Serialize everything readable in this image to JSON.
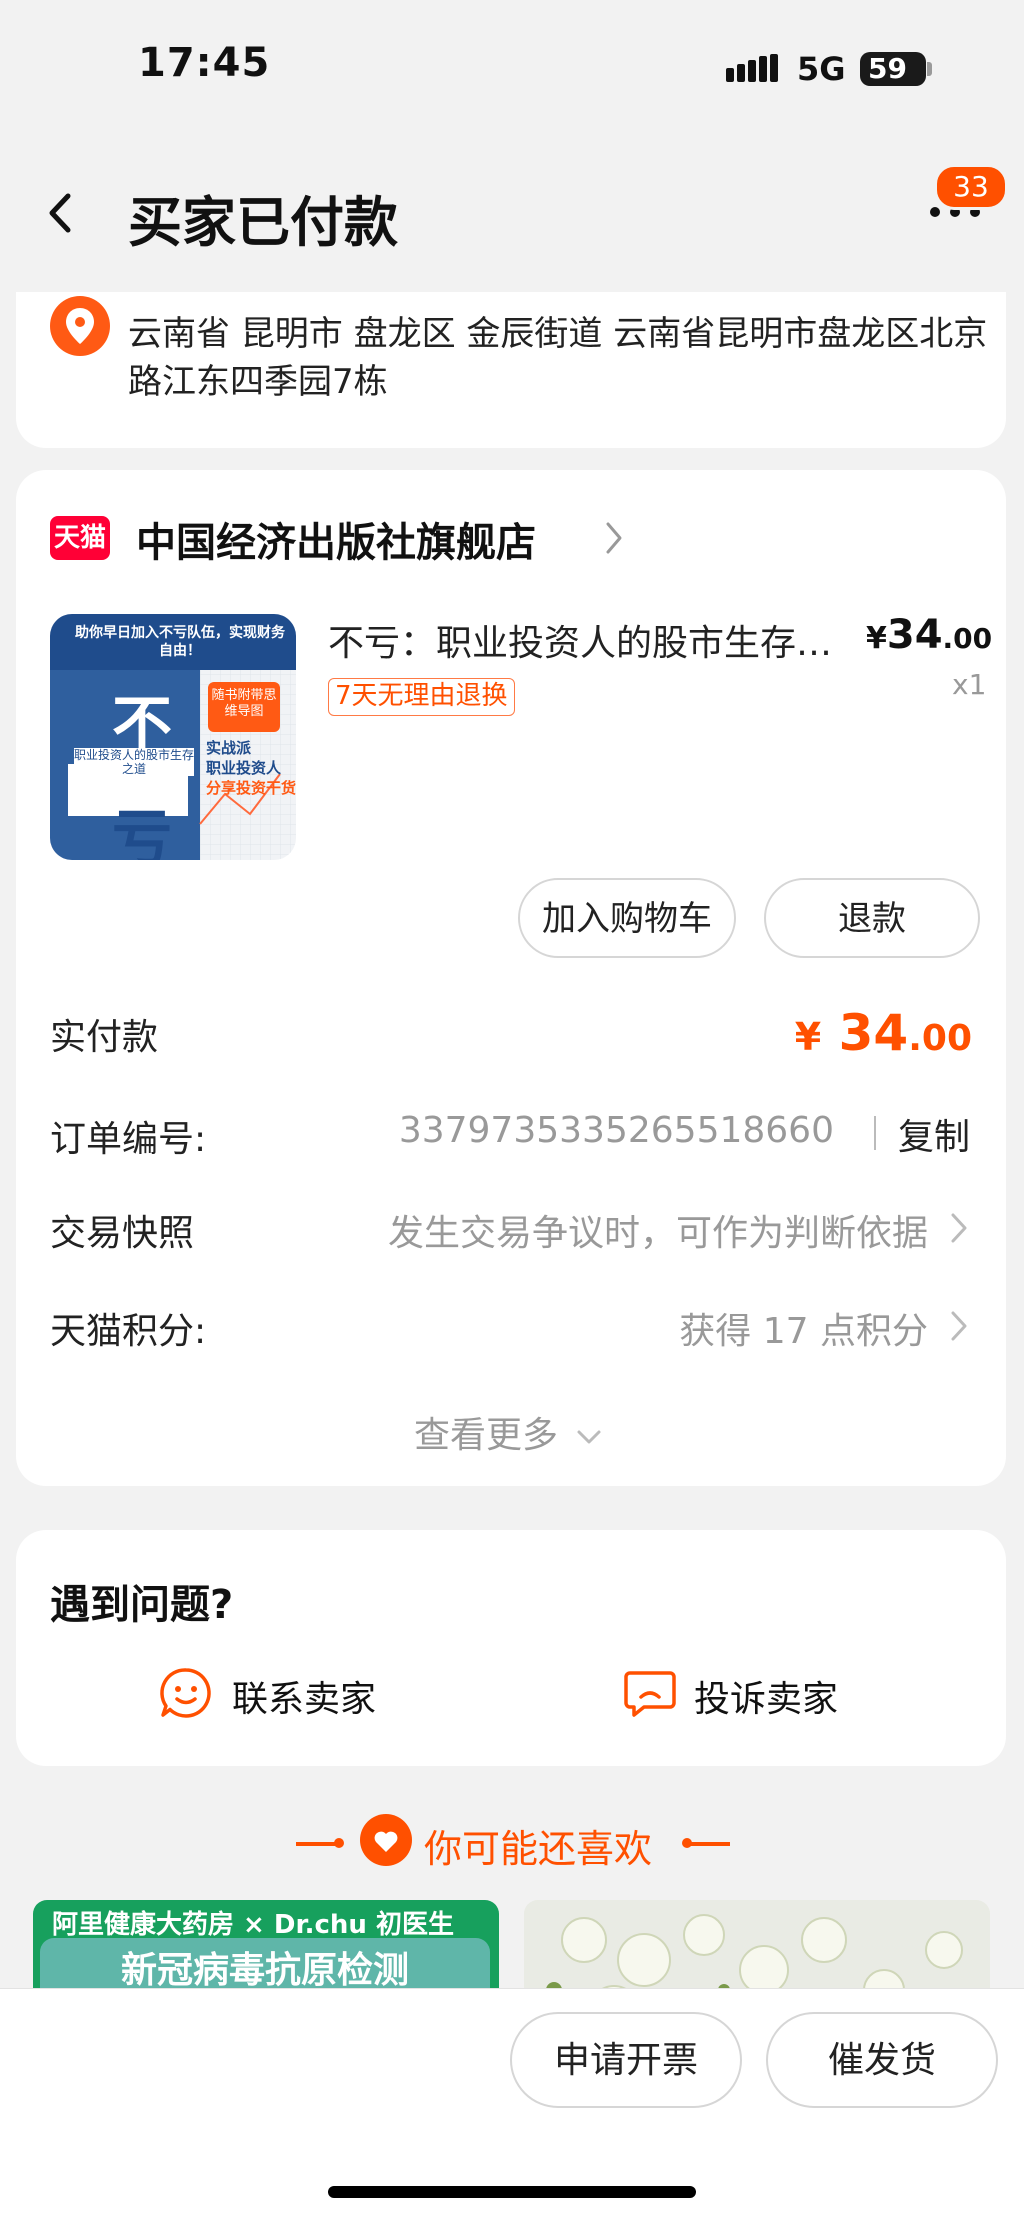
{
  "status_bar": {
    "time": "17:45",
    "network": "5G",
    "battery": "59"
  },
  "header": {
    "title": "买家已付款",
    "notification_count": "33"
  },
  "address": {
    "text": "云南省 昆明市 盘龙区 金辰街道 云南省昆明市盘龙区北京路江东四季园7栋"
  },
  "shop": {
    "badge": "天猫",
    "name": "中国经济出版社旗舰店"
  },
  "product": {
    "title": "不亏：职业投资人的股市生存之道",
    "price_currency": "¥",
    "price_int": "34",
    "price_dec": ".00",
    "qty": "x1",
    "return_tag": "7天无理由退换",
    "cover": {
      "banner": "助你早日加入不亏队伍，实现财务自由！",
      "big1": "不",
      "big2": "亏",
      "subtitle": "职业投资人的股市生存之道",
      "tag": "随书附带思维导图",
      "slogan1": "实战派",
      "slogan2": "职业投资人",
      "slogan3": "分享投资干货"
    }
  },
  "actions": {
    "add_to_cart": "加入购物车",
    "refund": "退款"
  },
  "payment": {
    "label": "实付款",
    "currency": "¥",
    "amount_int": "34",
    "amount_dec": ".00"
  },
  "order": {
    "label": "订单编号:",
    "number": "3379735335265518660",
    "copy": "复制"
  },
  "snapshot": {
    "label": "交易快照",
    "desc": "发生交易争议时，可作为判断依据"
  },
  "points": {
    "label": "天猫积分:",
    "desc": "获得 17 点积分"
  },
  "view_more": "查看更多",
  "problem": {
    "title": "遇到问题?",
    "contact": "联系卖家",
    "complain": "投诉卖家"
  },
  "recommend": {
    "title": "你可能还喜欢",
    "item1_brand": "阿里健康大药房 × Dr.chu 初医生",
    "item1_banner": "新冠病毒抗原检测"
  },
  "bottom": {
    "invoice": "申请开票",
    "urge": "催发货"
  },
  "colors": {
    "accent": "#ff5000",
    "tmall": "#ff0036"
  }
}
